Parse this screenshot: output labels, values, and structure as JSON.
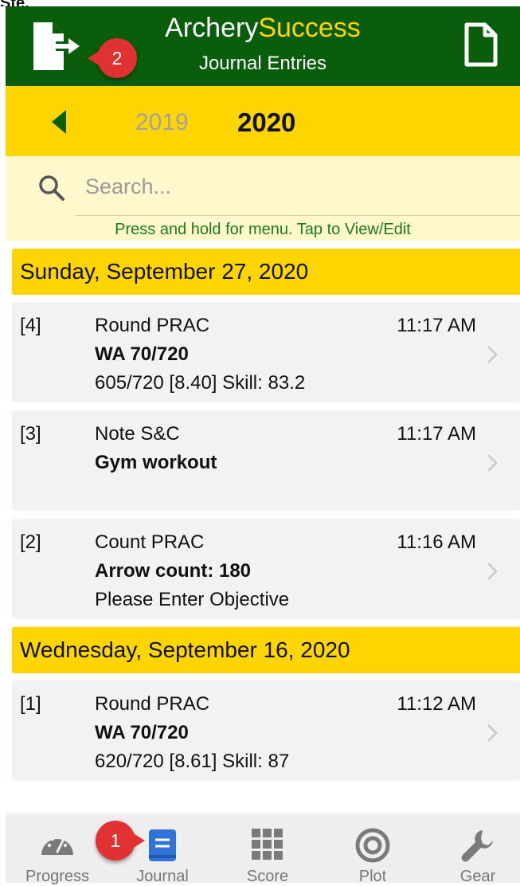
{
  "page_top_fragment": "Ste.",
  "header": {
    "brand_part1": "Archery",
    "brand_part2": "Success",
    "subtitle": "Journal Entries",
    "export_icon": "export-file-icon",
    "new_icon": "new-document-icon"
  },
  "annotations": {
    "badge_1": "1",
    "badge_2": "2"
  },
  "year_bar": {
    "prev_icon": "chevron-left-icon",
    "prev_year": "2019",
    "current_year": "2020"
  },
  "search": {
    "placeholder": "Search...",
    "value": "",
    "hint": "Press and hold for menu. Tap to View/Edit"
  },
  "groups": [
    {
      "date": "Sunday, September 27, 2020",
      "entries": [
        {
          "num": "[4]",
          "line1": "Round PRAC",
          "line2": "WA 70/720",
          "line3": "605/720 [8.40] Skill: 83.2",
          "time": "11:17 AM"
        },
        {
          "num": "[3]",
          "line1": "Note S&C",
          "line2": "Gym workout",
          "line3": "",
          "time": "11:17 AM"
        },
        {
          "num": "[2]",
          "line1": "Count PRAC",
          "line2": "Arrow count: 180",
          "line3": "Please Enter Objective",
          "time": "11:16 AM"
        }
      ]
    },
    {
      "date": "Wednesday, September 16, 2020",
      "entries": [
        {
          "num": "[1]",
          "line1": "Round PRAC",
          "line2": "WA 70/720",
          "line3": "620/720 [8.61] Skill: 87",
          "time": "11:12 AM"
        }
      ]
    }
  ],
  "bottom_nav": [
    {
      "label": "Progress",
      "icon": "speedometer-icon"
    },
    {
      "label": "Journal",
      "icon": "journal-icon",
      "active": true
    },
    {
      "label": "Score",
      "icon": "grid-icon"
    },
    {
      "label": "Plot",
      "icon": "target-icon"
    },
    {
      "label": "Gear",
      "icon": "wrench-icon"
    }
  ],
  "colors": {
    "header_green": "#0a5d0a",
    "accent_yellow": "#ffd500",
    "search_bg": "#fff8cc",
    "badge_red": "#e03232",
    "active_blue": "#2f73d8"
  }
}
